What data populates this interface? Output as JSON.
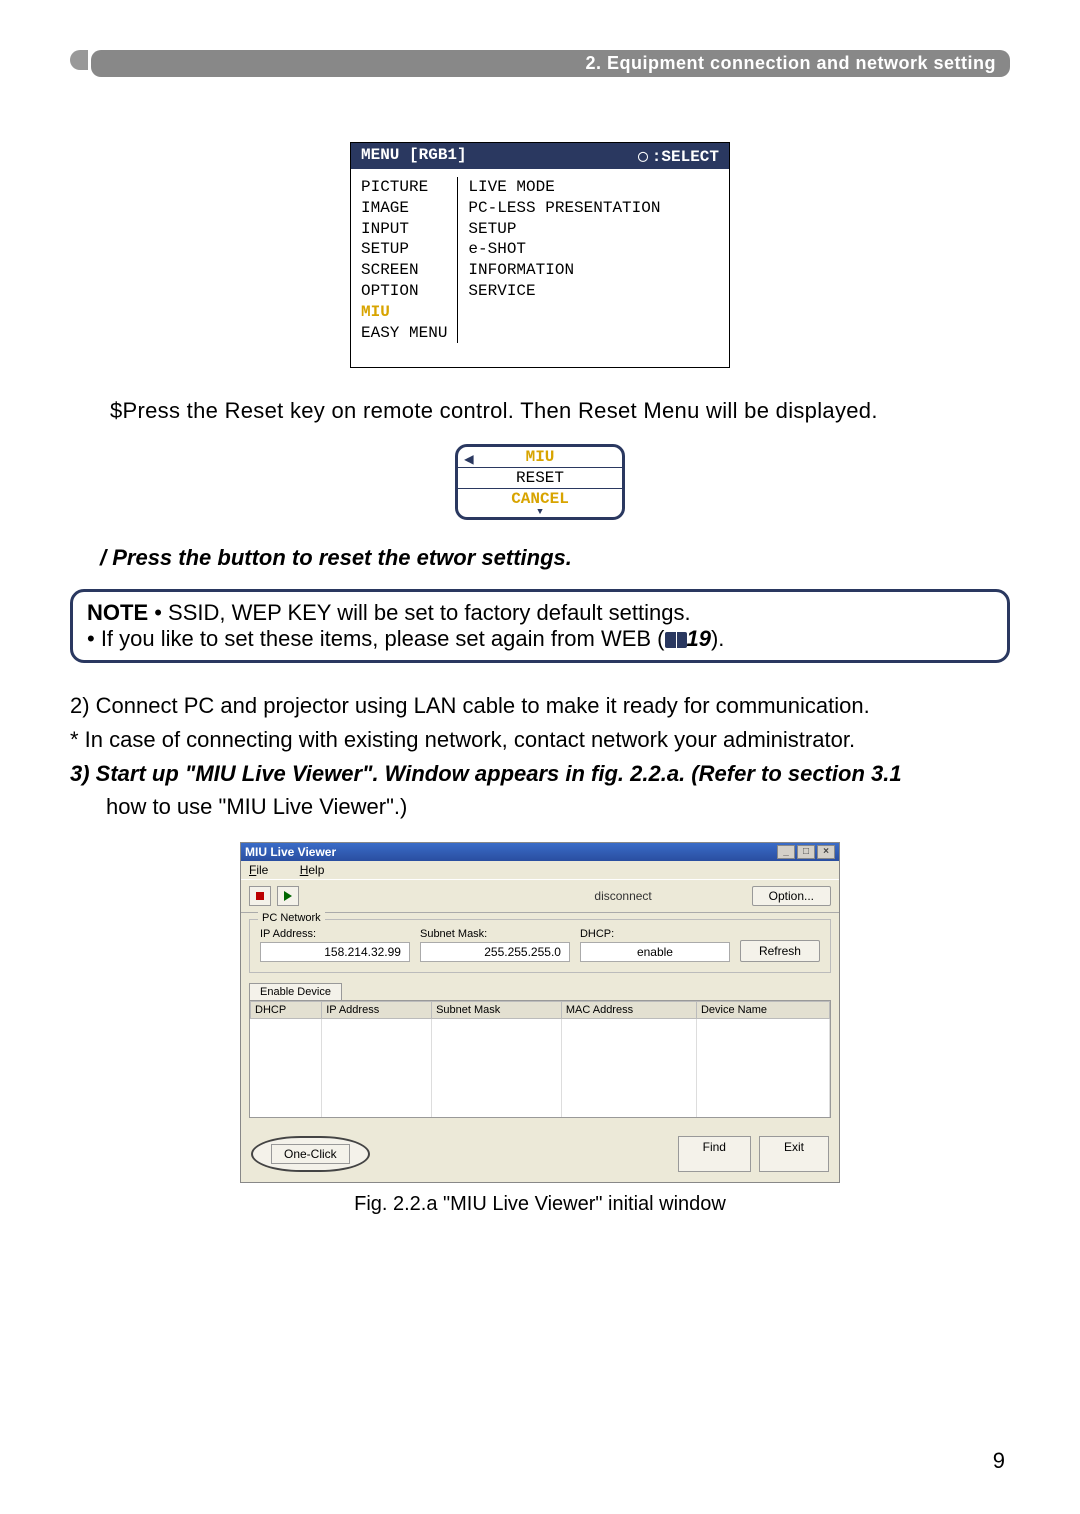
{
  "header": {
    "section_title": "2. Equipment connection and network setting"
  },
  "menu": {
    "title_left": "MENU [RGB1]",
    "title_right": ":SELECT",
    "left_items": [
      "PICTURE",
      "IMAGE",
      "INPUT",
      "SETUP",
      "SCREEN",
      "OPTION"
    ],
    "left_highlight": "MIU",
    "left_last": "EASY MENU",
    "right_items": [
      "LIVE MODE",
      "PC-LESS PRESENTATION",
      "SETUP",
      "e-SHOT",
      "INFORMATION",
      "SERVICE"
    ]
  },
  "text": {
    "step_reset": "$Press the Reset key on remote control. Then Reset Menu will be displayed.",
    "reset_title": "MIU",
    "reset_mid": "RESET",
    "reset_cancel": "CANCEL",
    "step_press_prefix": "/ Press the ",
    "step_press_mid": " button to reset the ",
    "step_press_mid2": "etwor",
    "step_press_end": " settings.",
    "note_label": "NOTE",
    "note_line1": " • SSID, WEP KEY will be set to factory default settings.",
    "note_line2a": "• If you like to set these items, please set again from WEB (",
    "note_ref": "19",
    "note_line2b": ").",
    "p2": "2) Connect PC and projector using LAN cable to make it ready for communication.",
    "p2b": "* In case of connecting with existing network, contact network your administrator.",
    "p3a": "3) Start up \"MIU Live Viewer\". Window appears in fig. 2.2.a. (Refer ",
    "p3b": "to section 3.1",
    "p3c": "how to use \"MIU Live Viewer\".)",
    "caption": "Fig. 2.2.a \"MIU Live Viewer\" initial window"
  },
  "viewer": {
    "title": "MIU Live Viewer",
    "menu_file": "File",
    "menu_help": "Help",
    "conn_status": "disconnect",
    "option_btn": "Option...",
    "pcnet_label": "PC Network",
    "ip_label": "IP Address:",
    "ip_val": "158.214.32.99",
    "mask_label": "Subnet Mask:",
    "mask_val": "255.255.255.0",
    "dhcp_label": "DHCP:",
    "dhcp_val": "enable",
    "refresh_btn": "Refresh",
    "tab_label": "Enable Device",
    "th1": "DHCP",
    "th2": "IP Address",
    "th3": "Subnet Mask",
    "th4": "MAC Address",
    "th5": "Device Name",
    "oneclick": "One-Click",
    "find": "Find",
    "exit": "Exit"
  },
  "page_number": "9"
}
